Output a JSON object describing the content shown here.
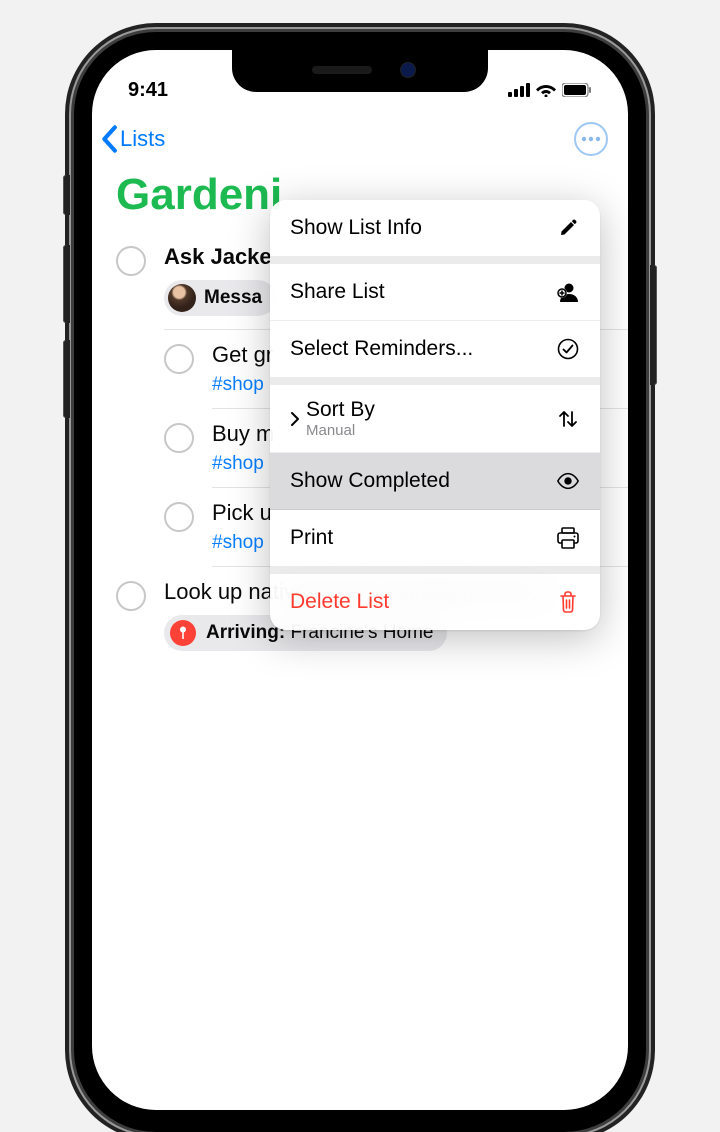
{
  "status": {
    "time": "9:41"
  },
  "nav": {
    "back_label": "Lists"
  },
  "list": {
    "title": "Gardeni"
  },
  "reminders": [
    {
      "title": "Ask Jacke",
      "bold": true
    },
    {
      "title": "Get gr",
      "tag": "#shop"
    },
    {
      "title": "Buy m",
      "tag": "#shop"
    },
    {
      "title": "Pick u",
      "tag": "#shop"
    },
    {
      "title": "Look up native vines for along the fence"
    }
  ],
  "message_badge": {
    "label": "Messa"
  },
  "location_badge": {
    "label_bold": "Arriving:",
    "label_rest": " Francine's Home"
  },
  "menu": {
    "show_info": "Show List Info",
    "share": "Share List",
    "select": "Select Reminders...",
    "sort_by": "Sort By",
    "sort_value": "Manual",
    "show_completed": "Show Completed",
    "print": "Print",
    "delete": "Delete List"
  }
}
